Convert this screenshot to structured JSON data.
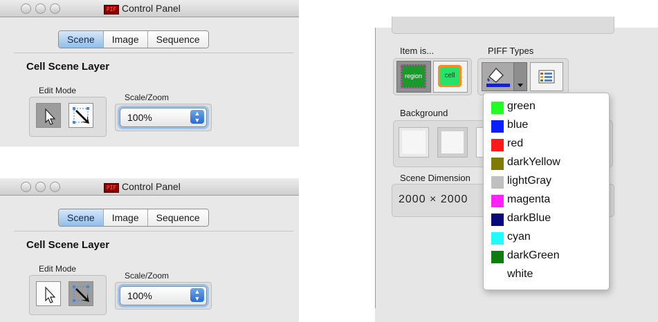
{
  "windows": [
    {
      "title": "Control Panel",
      "tabs": [
        "Scene",
        "Image",
        "Sequence"
      ],
      "active_tab": "Scene",
      "layer_title": "Cell Scene Layer",
      "edit_mode_label": "Edit Mode",
      "scale_label": "Scale/Zoom",
      "scale_value": "100%",
      "selected_tool": "select-arrow"
    },
    {
      "title": "Control Panel",
      "tabs": [
        "Scene",
        "Image",
        "Sequence"
      ],
      "active_tab": "Scene",
      "layer_title": "Cell Scene Layer",
      "edit_mode_label": "Edit Mode",
      "scale_label": "Scale/Zoom",
      "scale_value": "100%",
      "selected_tool": "resize-arrow"
    }
  ],
  "right_panel": {
    "item_is_label": "Item is...",
    "item_region_label": "region",
    "item_cell_label": "cell",
    "piff_types_label": "PIFF Types",
    "background_label": "Background",
    "scene_dimensions_label": "Scene Dimension",
    "scene_dimensions_value": "2000 × 2000"
  },
  "piff_menu": [
    {
      "label": "green",
      "color": "#22ff22"
    },
    {
      "label": "blue",
      "color": "#0a1eff"
    },
    {
      "label": "red",
      "color": "#ff1a1a"
    },
    {
      "label": "darkYellow",
      "color": "#807b00"
    },
    {
      "label": "lightGray",
      "color": "#c0c0c0"
    },
    {
      "label": "magenta",
      "color": "#ff22ff"
    },
    {
      "label": "darkBlue",
      "color": "#070a78"
    },
    {
      "label": "cyan",
      "color": "#1ffcfc"
    },
    {
      "label": "darkGreen",
      "color": "#0f7c0f"
    },
    {
      "label": "white",
      "color": "#ffffff"
    }
  ],
  "colors": {
    "accent": "#5b9ae6",
    "selected_tool_bg": "#9c9c9c"
  }
}
